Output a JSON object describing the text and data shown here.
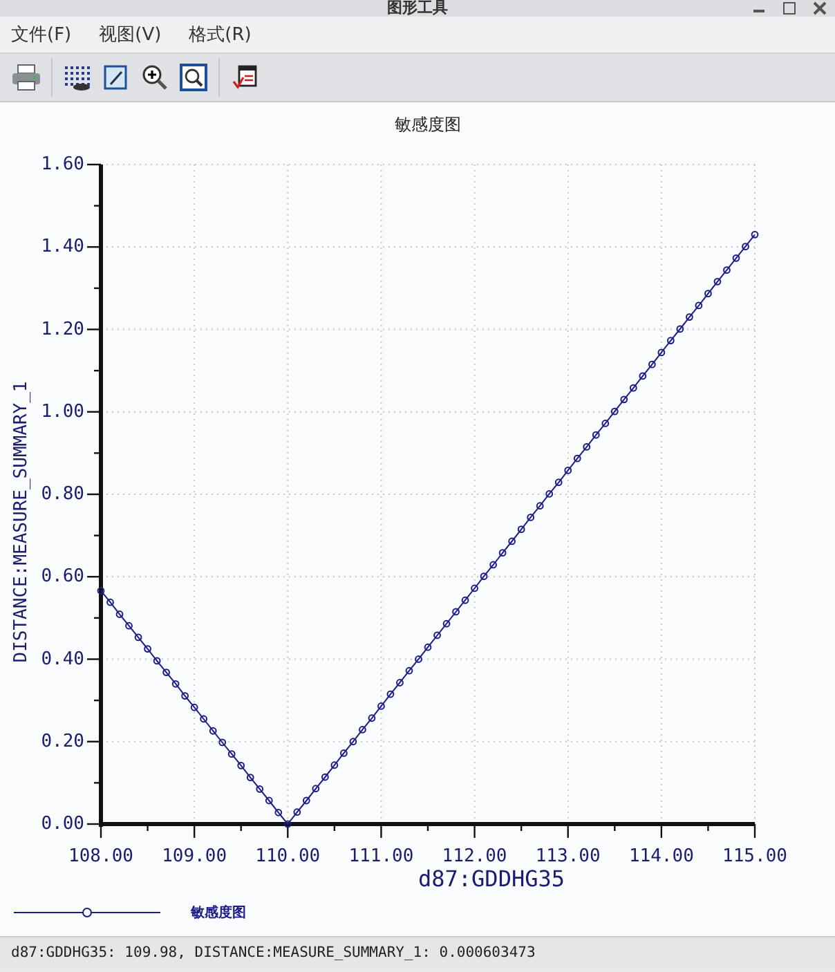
{
  "window": {
    "title": "图形工具"
  },
  "menu": [
    {
      "label": "文件(F)"
    },
    {
      "label": "视图(V)"
    },
    {
      "label": "格式(R)"
    }
  ],
  "toolbar": [
    {
      "kind": "print"
    },
    {
      "kind": "grid"
    },
    {
      "kind": "edit"
    },
    {
      "kind": "zoom-in"
    },
    {
      "kind": "zoom-fit"
    },
    {
      "kind": "export"
    }
  ],
  "chart": {
    "chart_data": {
      "type": "line",
      "title": "敏感度图",
      "xlabel": "d87:GDDHG35",
      "ylabel": "DISTANCE:MEASURE_SUMMARY_1",
      "grid": true,
      "xlim": [
        108,
        115
      ],
      "ylim": [
        0,
        1.6
      ],
      "xticks": [
        {
          "value": 108,
          "label": "108.00"
        },
        {
          "value": 109,
          "label": "109.00"
        },
        {
          "value": 110,
          "label": "110.00"
        },
        {
          "value": 111,
          "label": "111.00"
        },
        {
          "value": 112,
          "label": "112.00"
        },
        {
          "value": 113,
          "label": "113.00"
        },
        {
          "value": 114,
          "label": "114.00"
        },
        {
          "value": 115,
          "label": "115.00"
        }
      ],
      "yticks": [
        {
          "value": 0,
          "label": "0.00"
        },
        {
          "value": 0.2,
          "label": "0.20"
        },
        {
          "value": 0.4,
          "label": "0.40"
        },
        {
          "value": 0.6,
          "label": "0.60"
        },
        {
          "value": 0.8,
          "label": "0.80"
        },
        {
          "value": 1.0,
          "label": "1.00"
        },
        {
          "value": 1.2,
          "label": "1.20"
        },
        {
          "value": 1.4,
          "label": "1.40"
        },
        {
          "value": 1.6,
          "label": "1.60"
        }
      ],
      "x": [
        108.0,
        108.1,
        108.2,
        108.3,
        108.4,
        108.5,
        108.6,
        108.7,
        108.8,
        108.9,
        109.0,
        109.1,
        109.2,
        109.3,
        109.4,
        109.5,
        109.6,
        109.7,
        109.8,
        109.9,
        110.0,
        110.1,
        110.2,
        110.3,
        110.4,
        110.5,
        110.6,
        110.7,
        110.8,
        110.9,
        111.0,
        111.1,
        111.2,
        111.3,
        111.4,
        111.5,
        111.6,
        111.7,
        111.8,
        111.9,
        112.0,
        112.1,
        112.2,
        112.3,
        112.4,
        112.5,
        112.6,
        112.7,
        112.8,
        112.9,
        113.0,
        113.1,
        113.2,
        113.3,
        113.4,
        113.5,
        113.6,
        113.7,
        113.8,
        113.9,
        114.0,
        114.1,
        114.2,
        114.3,
        114.4,
        114.5,
        114.6,
        114.7,
        114.8,
        114.9,
        115.0
      ],
      "series": [
        {
          "name": "敏感度图",
          "color": "#1c1c88",
          "marker": "circle",
          "values": [
            0.566,
            0.538,
            0.509,
            0.481,
            0.453,
            0.425,
            0.396,
            0.368,
            0.34,
            0.311,
            0.283,
            0.255,
            0.226,
            0.198,
            0.17,
            0.142,
            0.113,
            0.085,
            0.057,
            0.028,
            0.0,
            0.029,
            0.057,
            0.086,
            0.114,
            0.143,
            0.172,
            0.2,
            0.229,
            0.257,
            0.286,
            0.315,
            0.343,
            0.372,
            0.4,
            0.429,
            0.458,
            0.486,
            0.515,
            0.543,
            0.572,
            0.601,
            0.629,
            0.658,
            0.686,
            0.715,
            0.744,
            0.772,
            0.801,
            0.829,
            0.858,
            0.887,
            0.915,
            0.944,
            0.972,
            1.001,
            1.03,
            1.058,
            1.087,
            1.115,
            1.144,
            1.173,
            1.201,
            1.23,
            1.258,
            1.287,
            1.316,
            1.344,
            1.373,
            1.401,
            1.43
          ]
        }
      ]
    }
  },
  "status_bar": "d87:GDDHG35: 109.98, DISTANCE:MEASURE_SUMMARY_1: 0.000603473"
}
